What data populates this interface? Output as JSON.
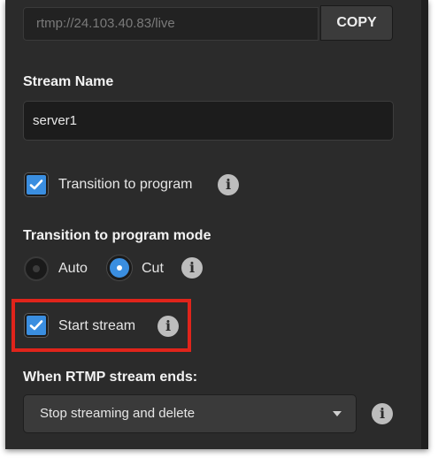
{
  "stream_url": {
    "value": "rtmp://24.103.40.83/live",
    "copy_label": "COPY"
  },
  "stream_name": {
    "label": "Stream Name",
    "value": "server1"
  },
  "transition_to_program": {
    "label": "Transition to program",
    "checked": true,
    "info_icon": "info-icon"
  },
  "transition_mode": {
    "label": "Transition to program mode",
    "options": [
      {
        "label": "Auto",
        "selected": false
      },
      {
        "label": "Cut",
        "selected": true
      }
    ],
    "info_icon": "info-icon"
  },
  "start_stream": {
    "label": "Start stream",
    "checked": true,
    "highlighted": true,
    "highlight_color": "#e0241b",
    "info_icon": "info-icon"
  },
  "stream_end": {
    "label": "When RTMP stream ends:",
    "selected": "Stop streaming and delete",
    "info_icon": "info-icon"
  },
  "colors": {
    "accent": "#3a8ee0",
    "panel_bg": "#2b2b2b"
  }
}
